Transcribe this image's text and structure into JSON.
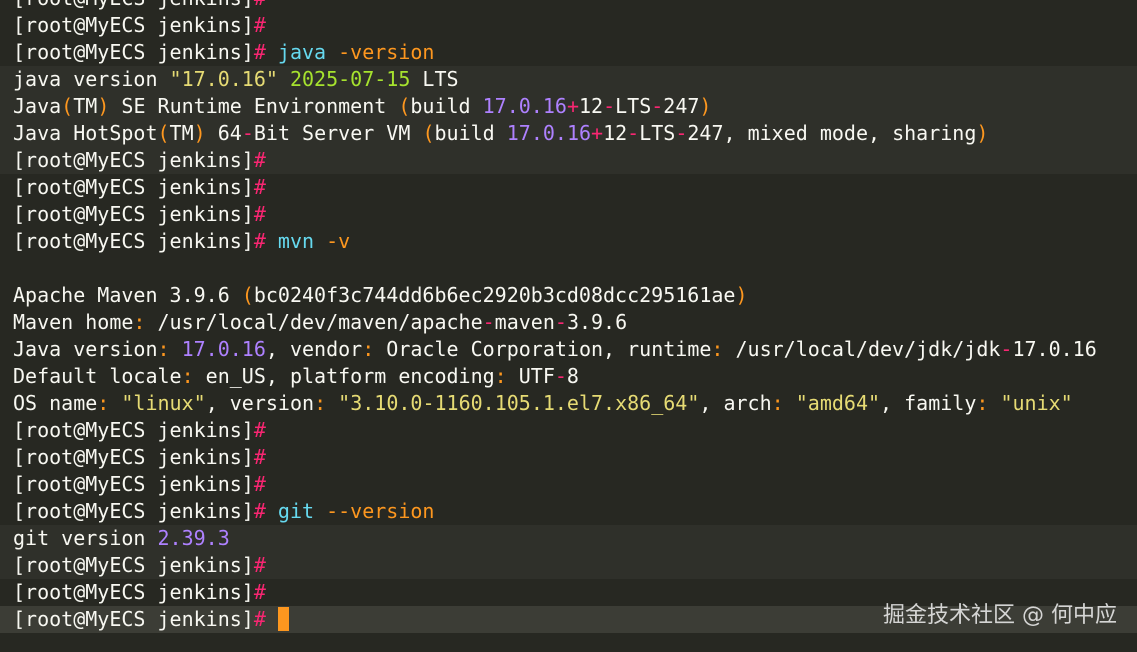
{
  "terminal": {
    "lines": [
      [
        [
          "[root@MyECS jenkins]",
          "white"
        ],
        [
          "#",
          "pink"
        ]
      ],
      [
        [
          "[root@MyECS jenkins]",
          "white"
        ],
        [
          "#",
          "pink"
        ]
      ],
      [
        [
          "[root@MyECS jenkins]",
          "white"
        ],
        [
          "#",
          "pink"
        ],
        [
          " java ",
          "cyan"
        ],
        [
          "-version",
          "orange"
        ]
      ],
      [
        [
          "java version ",
          "white"
        ],
        [
          "\"17.0.16\"",
          "yellow"
        ],
        [
          " ",
          "white"
        ],
        [
          "2025-07-15",
          "green"
        ],
        [
          " LTS",
          "white"
        ]
      ],
      [
        [
          "Java",
          "white"
        ],
        [
          "(",
          "orange"
        ],
        [
          "TM",
          "white"
        ],
        [
          ")",
          "orange"
        ],
        [
          " SE Runtime Environment ",
          "white"
        ],
        [
          "(",
          "orange"
        ],
        [
          "build ",
          "white"
        ],
        [
          "17.0.16",
          "purple"
        ],
        [
          "+",
          "pink"
        ],
        [
          "12",
          "white"
        ],
        [
          "-",
          "pink"
        ],
        [
          "LTS",
          "white"
        ],
        [
          "-",
          "pink"
        ],
        [
          "247",
          "white"
        ],
        [
          ")",
          "orange"
        ]
      ],
      [
        [
          "Java HotSpot",
          "white"
        ],
        [
          "(",
          "orange"
        ],
        [
          "TM",
          "white"
        ],
        [
          ")",
          "orange"
        ],
        [
          " 64",
          "white"
        ],
        [
          "-",
          "pink"
        ],
        [
          "Bit Server VM ",
          "white"
        ],
        [
          "(",
          "orange"
        ],
        [
          "build ",
          "white"
        ],
        [
          "17.0.16",
          "purple"
        ],
        [
          "+",
          "pink"
        ],
        [
          "12",
          "white"
        ],
        [
          "-",
          "pink"
        ],
        [
          "LTS",
          "white"
        ],
        [
          "-",
          "pink"
        ],
        [
          "247, mixed mode, sharing",
          "white"
        ],
        [
          ")",
          "orange"
        ]
      ],
      [
        [
          "[root@MyECS jenkins]",
          "white"
        ],
        [
          "#",
          "pink"
        ]
      ],
      [
        [
          "[root@MyECS jenkins]",
          "white"
        ],
        [
          "#",
          "pink"
        ]
      ],
      [
        [
          "[root@MyECS jenkins]",
          "white"
        ],
        [
          "#",
          "pink"
        ]
      ],
      [
        [
          "[root@MyECS jenkins]",
          "white"
        ],
        [
          "#",
          "pink"
        ],
        [
          " mvn ",
          "cyan"
        ],
        [
          "-v",
          "orange"
        ]
      ],
      [],
      [
        [
          "Apache Maven 3.9.6 ",
          "white"
        ],
        [
          "(",
          "orange"
        ],
        [
          "bc0240f3c744dd6b6ec2920b3cd08dcc295161ae",
          "white"
        ],
        [
          ")",
          "orange"
        ]
      ],
      [
        [
          "Maven home",
          "white"
        ],
        [
          ":",
          "orange"
        ],
        [
          " /usr/local/dev/maven/apache",
          "white"
        ],
        [
          "-",
          "pink"
        ],
        [
          "maven",
          "white"
        ],
        [
          "-",
          "pink"
        ],
        [
          "3.9.6",
          "white"
        ]
      ],
      [
        [
          "Java version",
          "white"
        ],
        [
          ":",
          "orange"
        ],
        [
          " ",
          "white"
        ],
        [
          "17.0.16",
          "purple"
        ],
        [
          ", vendor",
          "white"
        ],
        [
          ":",
          "orange"
        ],
        [
          " Oracle Corporation, runtime",
          "white"
        ],
        [
          ":",
          "orange"
        ],
        [
          " /usr/local/dev/jdk/jdk",
          "white"
        ],
        [
          "-",
          "pink"
        ],
        [
          "17.0.16",
          "white"
        ]
      ],
      [
        [
          "Default locale",
          "white"
        ],
        [
          ":",
          "orange"
        ],
        [
          " en_US, platform encoding",
          "white"
        ],
        [
          ":",
          "orange"
        ],
        [
          " UTF",
          "white"
        ],
        [
          "-",
          "pink"
        ],
        [
          "8",
          "white"
        ]
      ],
      [
        [
          "OS name",
          "white"
        ],
        [
          ":",
          "orange"
        ],
        [
          " ",
          "white"
        ],
        [
          "\"linux\"",
          "yellow"
        ],
        [
          ", version",
          "white"
        ],
        [
          ":",
          "orange"
        ],
        [
          " ",
          "white"
        ],
        [
          "\"3.10.0-1160.105.1.el7.x86_64\"",
          "yellow"
        ],
        [
          ", arch",
          "white"
        ],
        [
          ":",
          "orange"
        ],
        [
          " ",
          "white"
        ],
        [
          "\"amd64\"",
          "yellow"
        ],
        [
          ", family",
          "white"
        ],
        [
          ":",
          "orange"
        ],
        [
          " ",
          "white"
        ],
        [
          "\"unix\"",
          "yellow"
        ]
      ],
      [
        [
          "[root@MyECS jenkins]",
          "white"
        ],
        [
          "#",
          "pink"
        ]
      ],
      [
        [
          "[root@MyECS jenkins]",
          "white"
        ],
        [
          "#",
          "pink"
        ]
      ],
      [
        [
          "[root@MyECS jenkins]",
          "white"
        ],
        [
          "#",
          "pink"
        ]
      ],
      [
        [
          "[root@MyECS jenkins]",
          "white"
        ],
        [
          "#",
          "pink"
        ],
        [
          " git ",
          "cyan"
        ],
        [
          "--version",
          "orange"
        ]
      ],
      [
        [
          "git version ",
          "white"
        ],
        [
          "2.39.3",
          "purple"
        ]
      ],
      [
        [
          "[root@MyECS jenkins]",
          "white"
        ],
        [
          "#",
          "pink"
        ]
      ],
      [
        [
          "[root@MyECS jenkins]",
          "white"
        ],
        [
          "#",
          "pink"
        ]
      ],
      [
        [
          "[root@MyECS jenkins]",
          "white"
        ],
        [
          "#",
          "pink"
        ],
        [
          " ",
          "white"
        ]
      ]
    ],
    "cursor_icon": "block-cursor-icon",
    "watermark": "掘金技术社区 @ 何中应"
  },
  "colors": {
    "background": "#272822",
    "white": "#f8f8f2",
    "pink": "#f92672",
    "cyan": "#66d9ef",
    "orange": "#fd971f",
    "yellow": "#e6db74",
    "purple": "#ae81ff",
    "green": "#a6e22e"
  }
}
